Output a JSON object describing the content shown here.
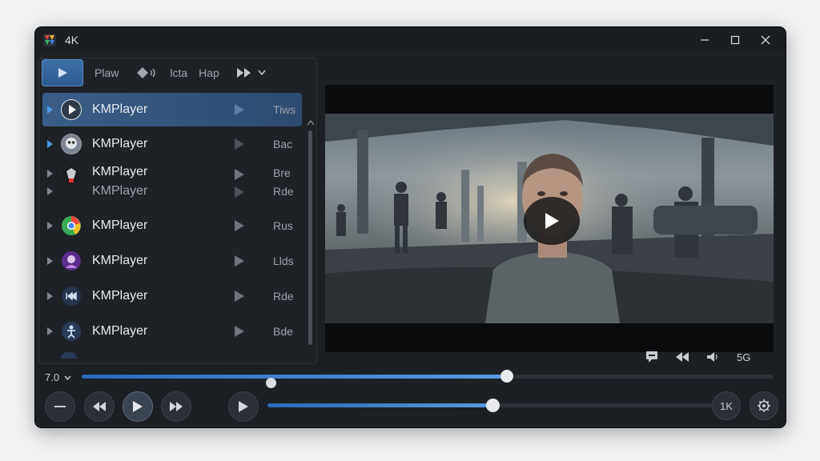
{
  "window": {
    "title": "4K"
  },
  "tabs": {
    "items": [
      {
        "label": "Plaw"
      },
      {
        "label": "lcta"
      },
      {
        "label": "Hap"
      }
    ]
  },
  "playlist": [
    {
      "name": "KMPlayer",
      "meta": "Tiws",
      "selected": true
    },
    {
      "name": "KMPlayer",
      "meta": "Bac"
    },
    {
      "name": "KMPlayer",
      "meta": "Bre",
      "sub_name": "KMPlayer",
      "sub_meta": "Rde"
    },
    {
      "name": "KMPlayer",
      "meta": "Rus"
    },
    {
      "name": "KMPlayer",
      "meta": "Llds"
    },
    {
      "name": "KMPlayer",
      "meta": "Rde"
    },
    {
      "name": "KMPlayer",
      "meta": "Bde"
    }
  ],
  "video_tools": {
    "quality_label": "5G"
  },
  "playback": {
    "speed_label": "7.0",
    "progress": 0.615,
    "volume": 0.505,
    "quality_button": "1K"
  },
  "colors": {
    "accent": "#4c9be8",
    "window_bg": "#1c1f24"
  }
}
